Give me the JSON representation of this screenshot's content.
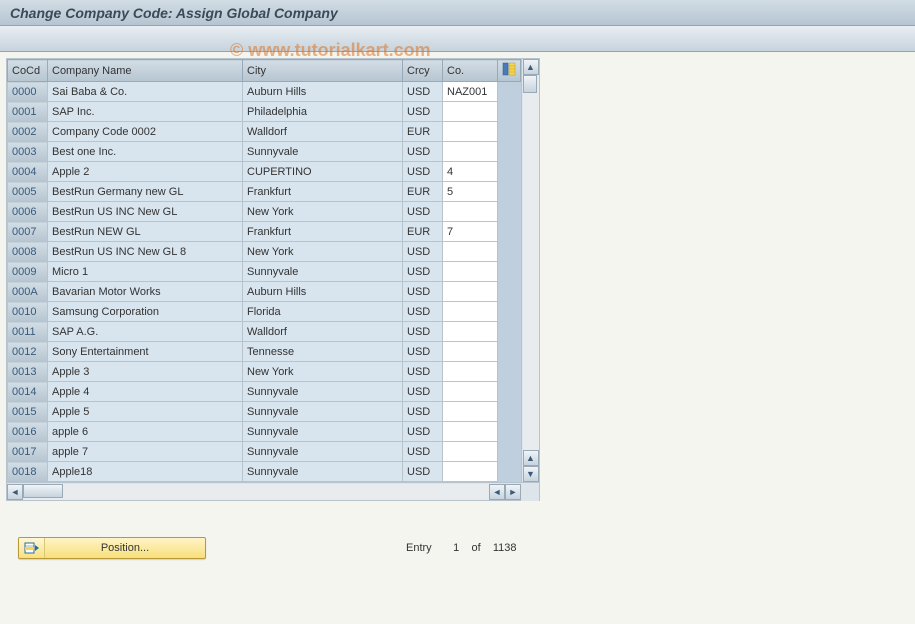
{
  "window_title": "Change Company Code: Assign Global Company",
  "watermark": "© www.tutorialkart.com",
  "columns": {
    "cocd": "CoCd",
    "name": "Company Name",
    "city": "City",
    "crcy": "Crcy",
    "co": "Co."
  },
  "rows": [
    {
      "cocd": "0000",
      "name": "Sai Baba & Co.",
      "city": "Auburn Hills",
      "crcy": "USD",
      "co": "NAZ001"
    },
    {
      "cocd": "0001",
      "name": "SAP Inc.",
      "city": "Philadelphia",
      "crcy": "USD",
      "co": ""
    },
    {
      "cocd": "0002",
      "name": "Company Code 0002",
      "city": "Walldorf",
      "crcy": "EUR",
      "co": ""
    },
    {
      "cocd": "0003",
      "name": "Best one Inc.",
      "city": "Sunnyvale",
      "crcy": "USD",
      "co": ""
    },
    {
      "cocd": "0004",
      "name": "Apple 2",
      "city": "CUPERTINO",
      "crcy": "USD",
      "co": "4"
    },
    {
      "cocd": "0005",
      "name": "BestRun Germany new GL",
      "city": "Frankfurt",
      "crcy": "EUR",
      "co": "5"
    },
    {
      "cocd": "0006",
      "name": "BestRun US INC New GL",
      "city": "New York",
      "crcy": "USD",
      "co": ""
    },
    {
      "cocd": "0007",
      "name": "BestRun NEW GL",
      "city": "Frankfurt",
      "crcy": "EUR",
      "co": "7"
    },
    {
      "cocd": "0008",
      "name": "BestRun US INC New GL 8",
      "city": "New York",
      "crcy": "USD",
      "co": ""
    },
    {
      "cocd": "0009",
      "name": "Micro 1",
      "city": "Sunnyvale",
      "crcy": "USD",
      "co": ""
    },
    {
      "cocd": "000A",
      "name": "Bavarian Motor Works",
      "city": "Auburn Hills",
      "crcy": "USD",
      "co": ""
    },
    {
      "cocd": "0010",
      "name": "Samsung Corporation",
      "city": "Florida",
      "crcy": "USD",
      "co": ""
    },
    {
      "cocd": "0011",
      "name": "SAP A.G.",
      "city": "Walldorf",
      "crcy": "USD",
      "co": ""
    },
    {
      "cocd": "0012",
      "name": "Sony Entertainment",
      "city": "Tennesse",
      "crcy": "USD",
      "co": ""
    },
    {
      "cocd": "0013",
      "name": "Apple 3",
      "city": "New York",
      "crcy": "USD",
      "co": ""
    },
    {
      "cocd": "0014",
      "name": "Apple 4",
      "city": "Sunnyvale",
      "crcy": "USD",
      "co": ""
    },
    {
      "cocd": "0015",
      "name": "Apple 5",
      "city": "Sunnyvale",
      "crcy": "USD",
      "co": ""
    },
    {
      "cocd": "0016",
      "name": "apple 6",
      "city": "Sunnyvale",
      "crcy": "USD",
      "co": ""
    },
    {
      "cocd": "0017",
      "name": "apple 7",
      "city": "Sunnyvale",
      "crcy": "USD",
      "co": ""
    },
    {
      "cocd": "0018",
      "name": "Apple18",
      "city": "Sunnyvale",
      "crcy": "USD",
      "co": ""
    }
  ],
  "footer": {
    "position_label": "Position...",
    "entry_label": "Entry",
    "entry_current": "1",
    "entry_of": "of",
    "entry_total": "1138"
  }
}
